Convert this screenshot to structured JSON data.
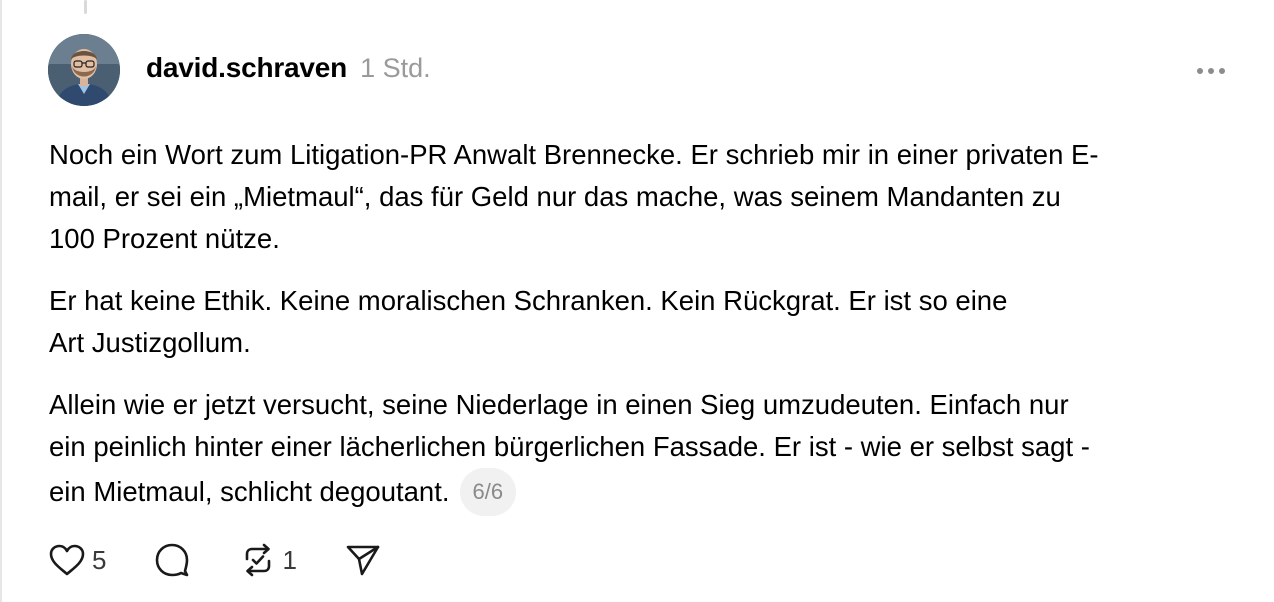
{
  "post": {
    "username": "david.schraven",
    "timestamp": "1 Std.",
    "paragraphs": [
      "Noch ein Wort zum Litigation-PR Anwalt Brennecke. Er schrieb mir in einer privaten E-\nmail, er sei ein „Mietmaul“, das für Geld nur das mache, was seinem Mandanten zu\n100 Prozent nütze.",
      "Er hat keine Ethik. Keine moralischen Schranken. Kein Rückgrat. Er ist so eine\nArt Justizgollum.",
      "Allein wie er jetzt versucht, seine Niederlage in einen Sieg umzudeuten. Einfach nur\nein peinlich hinter einer lächerlichen bürgerlichen Fassade. Er ist - wie er selbst sagt -\nein Mietmaul, schlicht degoutant."
    ],
    "page_indicator": "6/6"
  },
  "actions": {
    "like_icon": "heart-icon",
    "like_count": "5",
    "comment_icon": "comment-bubble-icon",
    "repost_icon": "repost-icon",
    "repost_count": "1",
    "share_icon": "send-icon",
    "more_icon": "more-horizontal-icon"
  },
  "colors": {
    "text": "#000000",
    "muted": "#9a9a9a",
    "badge_bg": "#f1f1f1"
  }
}
